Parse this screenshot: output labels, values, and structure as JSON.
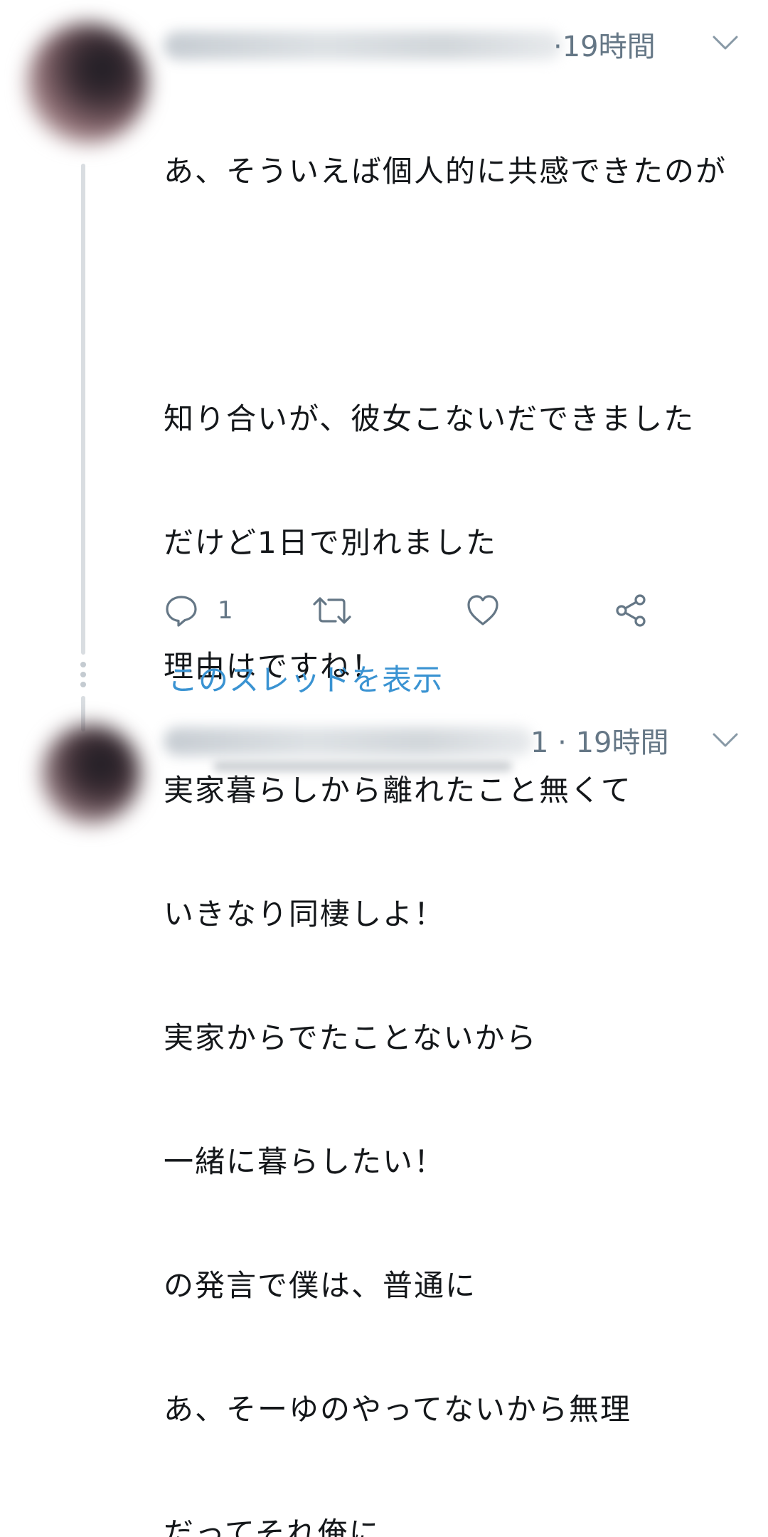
{
  "tweet": {
    "time": "19時間",
    "body_lines": [
      "あ、そういえば個人的に共感できたのが",
      "",
      "知り合いが、彼女こないだできました",
      "だけど1日で別れました",
      "理由はですね！",
      "実家暮らしから離れたこと無くて",
      "いきなり同棲しよ！",
      "実家からでたことないから",
      "一緒に暮らしたい！",
      "の発言で僕は、普通に",
      "あ、そーゆのやってないから無理",
      "だってそれ俺に"
    ],
    "reply_count": "1",
    "icons": [
      "reply-icon",
      "retweet-icon",
      "like-icon",
      "share-icon",
      "chevron-down-icon"
    ]
  },
  "thread_link": "このスレッドを表示",
  "next_tweet": {
    "meta": "1 · 19時間"
  },
  "colors": {
    "text": "#14171a",
    "secondary": "#657786",
    "link": "#3a93d2",
    "thread_line": "#d9dde1"
  }
}
